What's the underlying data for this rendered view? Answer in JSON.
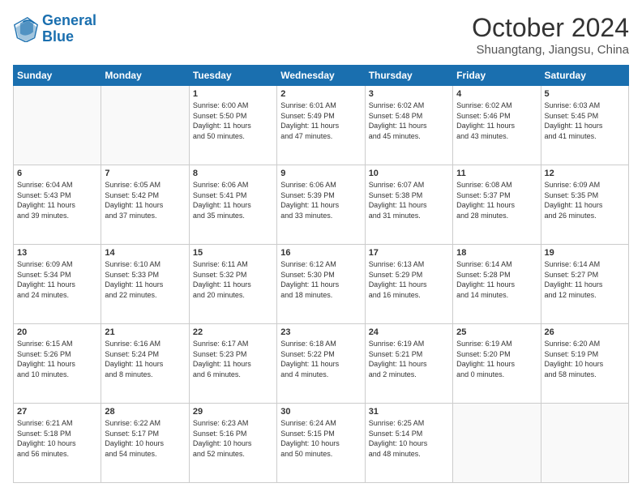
{
  "logo": {
    "line1": "General",
    "line2": "Blue"
  },
  "title": "October 2024",
  "subtitle": "Shuangtang, Jiangsu, China",
  "days_header": [
    "Sunday",
    "Monday",
    "Tuesday",
    "Wednesday",
    "Thursday",
    "Friday",
    "Saturday"
  ],
  "weeks": [
    [
      {
        "num": "",
        "text": ""
      },
      {
        "num": "",
        "text": ""
      },
      {
        "num": "1",
        "text": "Sunrise: 6:00 AM\nSunset: 5:50 PM\nDaylight: 11 hours\nand 50 minutes."
      },
      {
        "num": "2",
        "text": "Sunrise: 6:01 AM\nSunset: 5:49 PM\nDaylight: 11 hours\nand 47 minutes."
      },
      {
        "num": "3",
        "text": "Sunrise: 6:02 AM\nSunset: 5:48 PM\nDaylight: 11 hours\nand 45 minutes."
      },
      {
        "num": "4",
        "text": "Sunrise: 6:02 AM\nSunset: 5:46 PM\nDaylight: 11 hours\nand 43 minutes."
      },
      {
        "num": "5",
        "text": "Sunrise: 6:03 AM\nSunset: 5:45 PM\nDaylight: 11 hours\nand 41 minutes."
      }
    ],
    [
      {
        "num": "6",
        "text": "Sunrise: 6:04 AM\nSunset: 5:43 PM\nDaylight: 11 hours\nand 39 minutes."
      },
      {
        "num": "7",
        "text": "Sunrise: 6:05 AM\nSunset: 5:42 PM\nDaylight: 11 hours\nand 37 minutes."
      },
      {
        "num": "8",
        "text": "Sunrise: 6:06 AM\nSunset: 5:41 PM\nDaylight: 11 hours\nand 35 minutes."
      },
      {
        "num": "9",
        "text": "Sunrise: 6:06 AM\nSunset: 5:39 PM\nDaylight: 11 hours\nand 33 minutes."
      },
      {
        "num": "10",
        "text": "Sunrise: 6:07 AM\nSunset: 5:38 PM\nDaylight: 11 hours\nand 31 minutes."
      },
      {
        "num": "11",
        "text": "Sunrise: 6:08 AM\nSunset: 5:37 PM\nDaylight: 11 hours\nand 28 minutes."
      },
      {
        "num": "12",
        "text": "Sunrise: 6:09 AM\nSunset: 5:35 PM\nDaylight: 11 hours\nand 26 minutes."
      }
    ],
    [
      {
        "num": "13",
        "text": "Sunrise: 6:09 AM\nSunset: 5:34 PM\nDaylight: 11 hours\nand 24 minutes."
      },
      {
        "num": "14",
        "text": "Sunrise: 6:10 AM\nSunset: 5:33 PM\nDaylight: 11 hours\nand 22 minutes."
      },
      {
        "num": "15",
        "text": "Sunrise: 6:11 AM\nSunset: 5:32 PM\nDaylight: 11 hours\nand 20 minutes."
      },
      {
        "num": "16",
        "text": "Sunrise: 6:12 AM\nSunset: 5:30 PM\nDaylight: 11 hours\nand 18 minutes."
      },
      {
        "num": "17",
        "text": "Sunrise: 6:13 AM\nSunset: 5:29 PM\nDaylight: 11 hours\nand 16 minutes."
      },
      {
        "num": "18",
        "text": "Sunrise: 6:14 AM\nSunset: 5:28 PM\nDaylight: 11 hours\nand 14 minutes."
      },
      {
        "num": "19",
        "text": "Sunrise: 6:14 AM\nSunset: 5:27 PM\nDaylight: 11 hours\nand 12 minutes."
      }
    ],
    [
      {
        "num": "20",
        "text": "Sunrise: 6:15 AM\nSunset: 5:26 PM\nDaylight: 11 hours\nand 10 minutes."
      },
      {
        "num": "21",
        "text": "Sunrise: 6:16 AM\nSunset: 5:24 PM\nDaylight: 11 hours\nand 8 minutes."
      },
      {
        "num": "22",
        "text": "Sunrise: 6:17 AM\nSunset: 5:23 PM\nDaylight: 11 hours\nand 6 minutes."
      },
      {
        "num": "23",
        "text": "Sunrise: 6:18 AM\nSunset: 5:22 PM\nDaylight: 11 hours\nand 4 minutes."
      },
      {
        "num": "24",
        "text": "Sunrise: 6:19 AM\nSunset: 5:21 PM\nDaylight: 11 hours\nand 2 minutes."
      },
      {
        "num": "25",
        "text": "Sunrise: 6:19 AM\nSunset: 5:20 PM\nDaylight: 11 hours\nand 0 minutes."
      },
      {
        "num": "26",
        "text": "Sunrise: 6:20 AM\nSunset: 5:19 PM\nDaylight: 10 hours\nand 58 minutes."
      }
    ],
    [
      {
        "num": "27",
        "text": "Sunrise: 6:21 AM\nSunset: 5:18 PM\nDaylight: 10 hours\nand 56 minutes."
      },
      {
        "num": "28",
        "text": "Sunrise: 6:22 AM\nSunset: 5:17 PM\nDaylight: 10 hours\nand 54 minutes."
      },
      {
        "num": "29",
        "text": "Sunrise: 6:23 AM\nSunset: 5:16 PM\nDaylight: 10 hours\nand 52 minutes."
      },
      {
        "num": "30",
        "text": "Sunrise: 6:24 AM\nSunset: 5:15 PM\nDaylight: 10 hours\nand 50 minutes."
      },
      {
        "num": "31",
        "text": "Sunrise: 6:25 AM\nSunset: 5:14 PM\nDaylight: 10 hours\nand 48 minutes."
      },
      {
        "num": "",
        "text": ""
      },
      {
        "num": "",
        "text": ""
      }
    ]
  ]
}
